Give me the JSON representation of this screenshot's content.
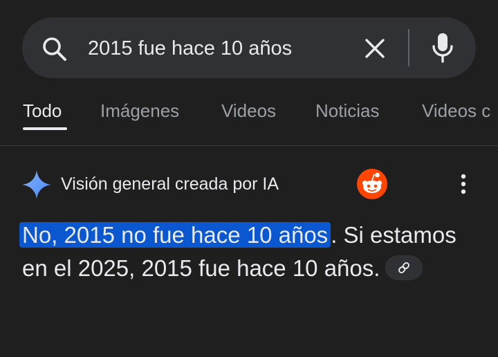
{
  "search": {
    "query": "2015 fue hace 10 años",
    "icon": "search-icon",
    "clear_icon": "close-icon",
    "mic_icon": "mic-icon"
  },
  "tabs": [
    {
      "label": "Todo",
      "active": true
    },
    {
      "label": "Imágenes",
      "active": false
    },
    {
      "label": "Videos",
      "active": false
    },
    {
      "label": "Noticias",
      "active": false
    },
    {
      "label": "Videos c",
      "active": false
    }
  ],
  "ai_overview": {
    "title": "Visión general creada por IA",
    "highlight": "No, 2015 no fue hace 10 años",
    "text_rest": ". Si estamos en el 2025, 2015 fue hace 10 años.",
    "source_icon": "reddit-icon",
    "link_icon": "link-icon",
    "menu_icon": "more-vert-icon"
  },
  "colors": {
    "background": "#1f1f1f",
    "search_bg": "#303134",
    "highlight": "#0b57d0",
    "gemini_blue": "#8ab4f8",
    "reddit": "#ff4500"
  }
}
